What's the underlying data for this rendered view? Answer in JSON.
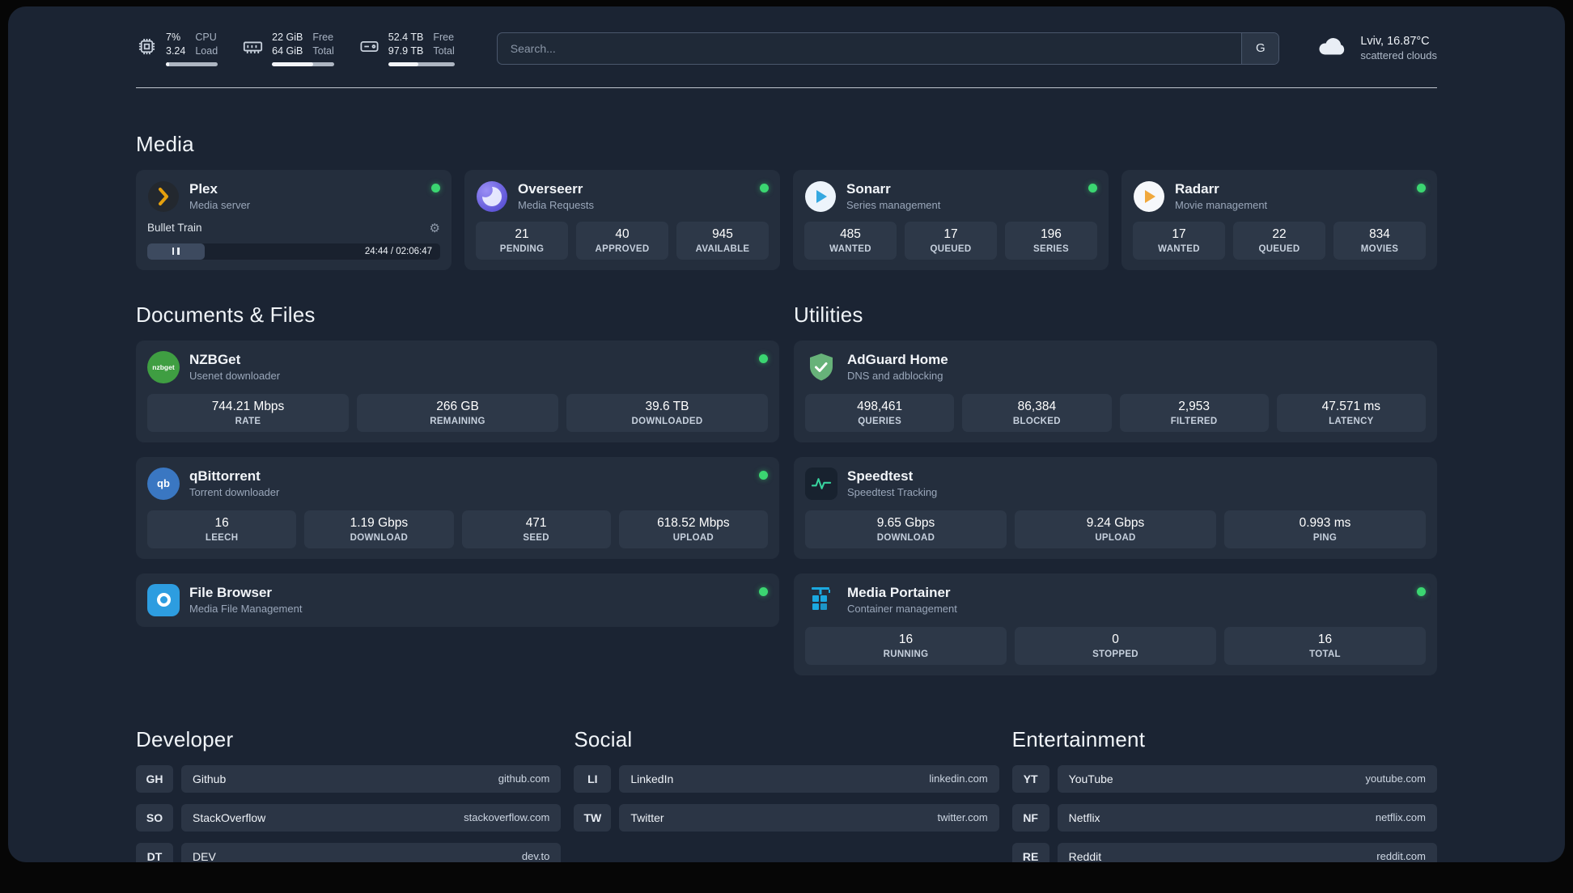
{
  "topbar": {
    "cpu": {
      "value_primary": "7%",
      "value_secondary": "3.24",
      "label_primary": "CPU",
      "label_secondary": "Load",
      "bar_percent": 7
    },
    "memory": {
      "value_primary": "22 GiB",
      "value_secondary": "64 GiB",
      "label_primary": "Free",
      "label_secondary": "Total",
      "bar_percent": 66
    },
    "disk": {
      "value_primary": "52.4 TB",
      "value_secondary": "97.9 TB",
      "label_primary": "Free",
      "label_secondary": "Total",
      "bar_percent": 46
    },
    "search": {
      "placeholder": "Search...",
      "provider_label": "G"
    },
    "weather": {
      "location": "Lviv, 16.87°C",
      "condition": "scattered clouds"
    }
  },
  "media": {
    "title": "Media",
    "plex": {
      "name": "Plex",
      "subtitle": "Media server",
      "now_playing": "Bullet Train",
      "time": "24:44 / 02:06:47",
      "progress_percent": 19.5
    },
    "overseerr": {
      "name": "Overseerr",
      "subtitle": "Media Requests",
      "stats": [
        {
          "value": "21",
          "label": "PENDING"
        },
        {
          "value": "40",
          "label": "APPROVED"
        },
        {
          "value": "945",
          "label": "AVAILABLE"
        }
      ]
    },
    "sonarr": {
      "name": "Sonarr",
      "subtitle": "Series management",
      "stats": [
        {
          "value": "485",
          "label": "WANTED"
        },
        {
          "value": "17",
          "label": "QUEUED"
        },
        {
          "value": "196",
          "label": "SERIES"
        }
      ]
    },
    "radarr": {
      "name": "Radarr",
      "subtitle": "Movie management",
      "stats": [
        {
          "value": "17",
          "label": "WANTED"
        },
        {
          "value": "22",
          "label": "QUEUED"
        },
        {
          "value": "834",
          "label": "MOVIES"
        }
      ]
    }
  },
  "documents": {
    "title": "Documents & Files",
    "nzbget": {
      "name": "NZBGet",
      "subtitle": "Usenet downloader",
      "logo_text": "nzbget",
      "stats": [
        {
          "value": "744.21 Mbps",
          "label": "RATE"
        },
        {
          "value": "266 GB",
          "label": "REMAINING"
        },
        {
          "value": "39.6 TB",
          "label": "DOWNLOADED"
        }
      ]
    },
    "qbittorrent": {
      "name": "qBittorrent",
      "subtitle": "Torrent downloader",
      "logo_text": "qb",
      "stats": [
        {
          "value": "16",
          "label": "LEECH"
        },
        {
          "value": "1.19 Gbps",
          "label": "DOWNLOAD"
        },
        {
          "value": "471",
          "label": "SEED"
        },
        {
          "value": "618.52 Mbps",
          "label": "UPLOAD"
        }
      ]
    },
    "filebrowser": {
      "name": "File Browser",
      "subtitle": "Media File Management"
    }
  },
  "utilities": {
    "title": "Utilities",
    "adguard": {
      "name": "AdGuard Home",
      "subtitle": "DNS and adblocking",
      "stats": [
        {
          "value": "498,461",
          "label": "QUERIES"
        },
        {
          "value": "86,384",
          "label": "BLOCKED"
        },
        {
          "value": "2,953",
          "label": "FILTERED"
        },
        {
          "value": "47.571 ms",
          "label": "LATENCY"
        }
      ]
    },
    "speedtest": {
      "name": "Speedtest",
      "subtitle": "Speedtest Tracking",
      "stats": [
        {
          "value": "9.65 Gbps",
          "label": "DOWNLOAD"
        },
        {
          "value": "9.24 Gbps",
          "label": "UPLOAD"
        },
        {
          "value": "0.993 ms",
          "label": "PING"
        }
      ]
    },
    "portainer": {
      "name": "Media Portainer",
      "subtitle": "Container management",
      "stats": [
        {
          "value": "16",
          "label": "RUNNING"
        },
        {
          "value": "0",
          "label": "STOPPED"
        },
        {
          "value": "16",
          "label": "TOTAL"
        }
      ]
    }
  },
  "bookmarks": {
    "developer": {
      "title": "Developer",
      "items": [
        {
          "abbr": "GH",
          "name": "Github",
          "url": "github.com"
        },
        {
          "abbr": "SO",
          "name": "StackOverflow",
          "url": "stackoverflow.com"
        },
        {
          "abbr": "DT",
          "name": "DEV",
          "url": "dev.to"
        }
      ]
    },
    "social": {
      "title": "Social",
      "items": [
        {
          "abbr": "LI",
          "name": "LinkedIn",
          "url": "linkedin.com"
        },
        {
          "abbr": "TW",
          "name": "Twitter",
          "url": "twitter.com"
        }
      ]
    },
    "entertainment": {
      "title": "Entertainment",
      "items": [
        {
          "abbr": "YT",
          "name": "YouTube",
          "url": "youtube.com"
        },
        {
          "abbr": "NF",
          "name": "Netflix",
          "url": "netflix.com"
        },
        {
          "abbr": "RE",
          "name": "Reddit",
          "url": "reddit.com"
        }
      ]
    }
  },
  "icons": {
    "gear_glyph": "⚙",
    "cpu": "chip-outline",
    "memory": "ram-stick-outline",
    "disk": "drive-outline",
    "weather": "cloud",
    "plex": "amber-chevron-in-dark-circle",
    "overseerr": "purple-swirl-circle",
    "sonarr": "blue-play-in-white-circle",
    "radarr": "orange-play-in-white-circle",
    "nzbget": "green-circle-wordmark",
    "qbittorrent": "blue-circle-qb",
    "filebrowser": "blue-square-white-ring",
    "adguard": "green-shield-check",
    "speedtest": "green-pulse-line",
    "portainer": "blue-crane-containers",
    "pause": "two-bars",
    "search_provider": "letter-G"
  },
  "colors": {
    "status_ok": "#3bd671",
    "plex": "#e5a00d",
    "overseerr_start": "#9a8ff5",
    "overseerr_end": "#544bd2",
    "sonarr": "#35a8e0",
    "radarr": "#f0a83c",
    "nzbget": "#3f9e42",
    "qbittorrent": "#3a77c2",
    "filebrowser": "#2d9de0",
    "adguard": "#67b279",
    "speedtest": "#38d39f",
    "portainer": "#1ba8e0",
    "bar_fill": "#f2f4f8"
  }
}
